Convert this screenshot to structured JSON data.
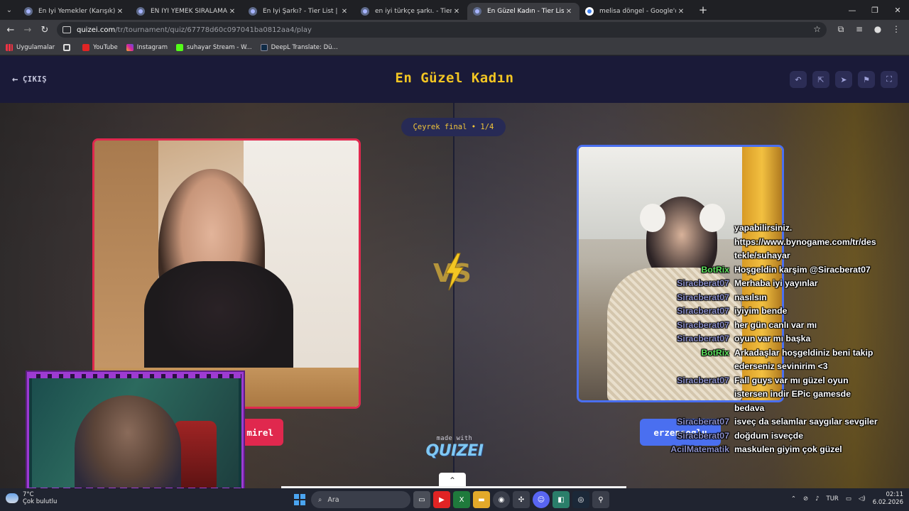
{
  "browser": {
    "tabs": [
      {
        "title": "En İyi Yemekler (Karışık) - Tier L",
        "active": false
      },
      {
        "title": "EN İYİ YEMEK SIRALAMASI (TÜ",
        "active": false
      },
      {
        "title": "En İyi Şarkı? - Tier List | Kör Sıra",
        "active": false
      },
      {
        "title": "en iyi türkçe şarkı. - Tier List, Kö",
        "active": false
      },
      {
        "title": "En Güzel Kadın - Tier List, Kör S",
        "active": true
      },
      {
        "title": "melisa döngel - Google'da Ara",
        "active": false
      }
    ],
    "url_domain": "quizei.com",
    "url_path": "/tr/tournament/quiz/67778d60c097041ba0812aa4/play",
    "bookmarks": [
      "Uygulamalar",
      "YouTube",
      "Instagram",
      "suhayar Stream - W...",
      "DeepL Translate: Dü..."
    ]
  },
  "header": {
    "exit_label": "ÇIKIŞ",
    "title": "En Güzel Kadın"
  },
  "arena": {
    "round_label": "Çeyrek final • 1/4",
    "left_name": "mirel",
    "right_name": "erzensoglu",
    "made_with": "made with",
    "logo_text": "QUIZEI"
  },
  "chat": [
    {
      "user": "",
      "msg": "yapabilirsiniz.",
      "bot": false
    },
    {
      "user": "",
      "msg": "https://www.bynogame.com/tr/des",
      "bot": false
    },
    {
      "user": "",
      "msg": "tekle/suhayar",
      "bot": false
    },
    {
      "user": "BotRix",
      "msg": "Hoşgeldin karşim @Siracberat07",
      "bot": true
    },
    {
      "user": "Siracberat07",
      "msg": "Merhaba iyi yayınlar",
      "bot": false
    },
    {
      "user": "Siracberat07",
      "msg": "nasılsın",
      "bot": false
    },
    {
      "user": "Siracberat07",
      "msg": "iyiyim bende",
      "bot": false
    },
    {
      "user": "Siracberat07",
      "msg": "her gün canlı var mı",
      "bot": false
    },
    {
      "user": "Siracberat07",
      "msg": "oyun var mı başka",
      "bot": false
    },
    {
      "user": "BotRix",
      "msg": "Arkadaşlar hoşgeldiniz beni takip",
      "bot": true
    },
    {
      "user": "",
      "msg": "ederseniz sevinirim <3",
      "bot": false
    },
    {
      "user": "Siracberat07",
      "msg": "Fall guys var mı güzel oyun",
      "bot": false
    },
    {
      "user": "",
      "msg": "istersen indir EPic gamesde",
      "bot": false
    },
    {
      "user": "",
      "msg": "bedava",
      "bot": false
    },
    {
      "user": "Siracberat07",
      "msg": "isveç da selamlar saygılar sevgiler",
      "bot": false
    },
    {
      "user": "Siracberat07",
      "msg": "doğdum isveçde",
      "bot": false
    },
    {
      "user": "AcilMatematik",
      "msg": "maskulen giyim çok güzel",
      "bot": false
    }
  ],
  "taskbar": {
    "weather_temp": "7°C",
    "weather_desc": "Çok bulutlu",
    "search_label": "Ara",
    "lang": "TUR",
    "time": "02:11",
    "date": "6.02.2026"
  },
  "colors": {
    "accent_yellow": "#f3c623",
    "left_border": "#e0284e",
    "right_border": "#4a6ff0",
    "header_bg": "#1a1a38"
  }
}
